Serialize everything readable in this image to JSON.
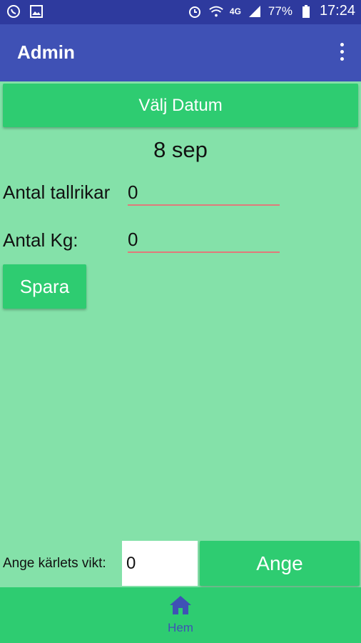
{
  "status": {
    "battery": "77%",
    "time": "17:24",
    "network": "4G"
  },
  "appbar": {
    "title": "Admin"
  },
  "main": {
    "pick_date_label": "Välj Datum",
    "date_value": "8 sep",
    "plates_label": "Antal tallrikar",
    "plates_value": "0",
    "kg_label": "Antal Kg:",
    "kg_value": "0",
    "save_label": "Spara"
  },
  "bottom": {
    "bin_weight_label": "Ange kärlets vikt:",
    "bin_weight_value": "0",
    "submit_label": "Ange"
  },
  "nav": {
    "home_label": "Hem"
  },
  "colors": {
    "background": "#84e1a9",
    "button": "#2ecc71",
    "appbar": "#3f51b5",
    "statusbar": "#2e3a9e"
  }
}
